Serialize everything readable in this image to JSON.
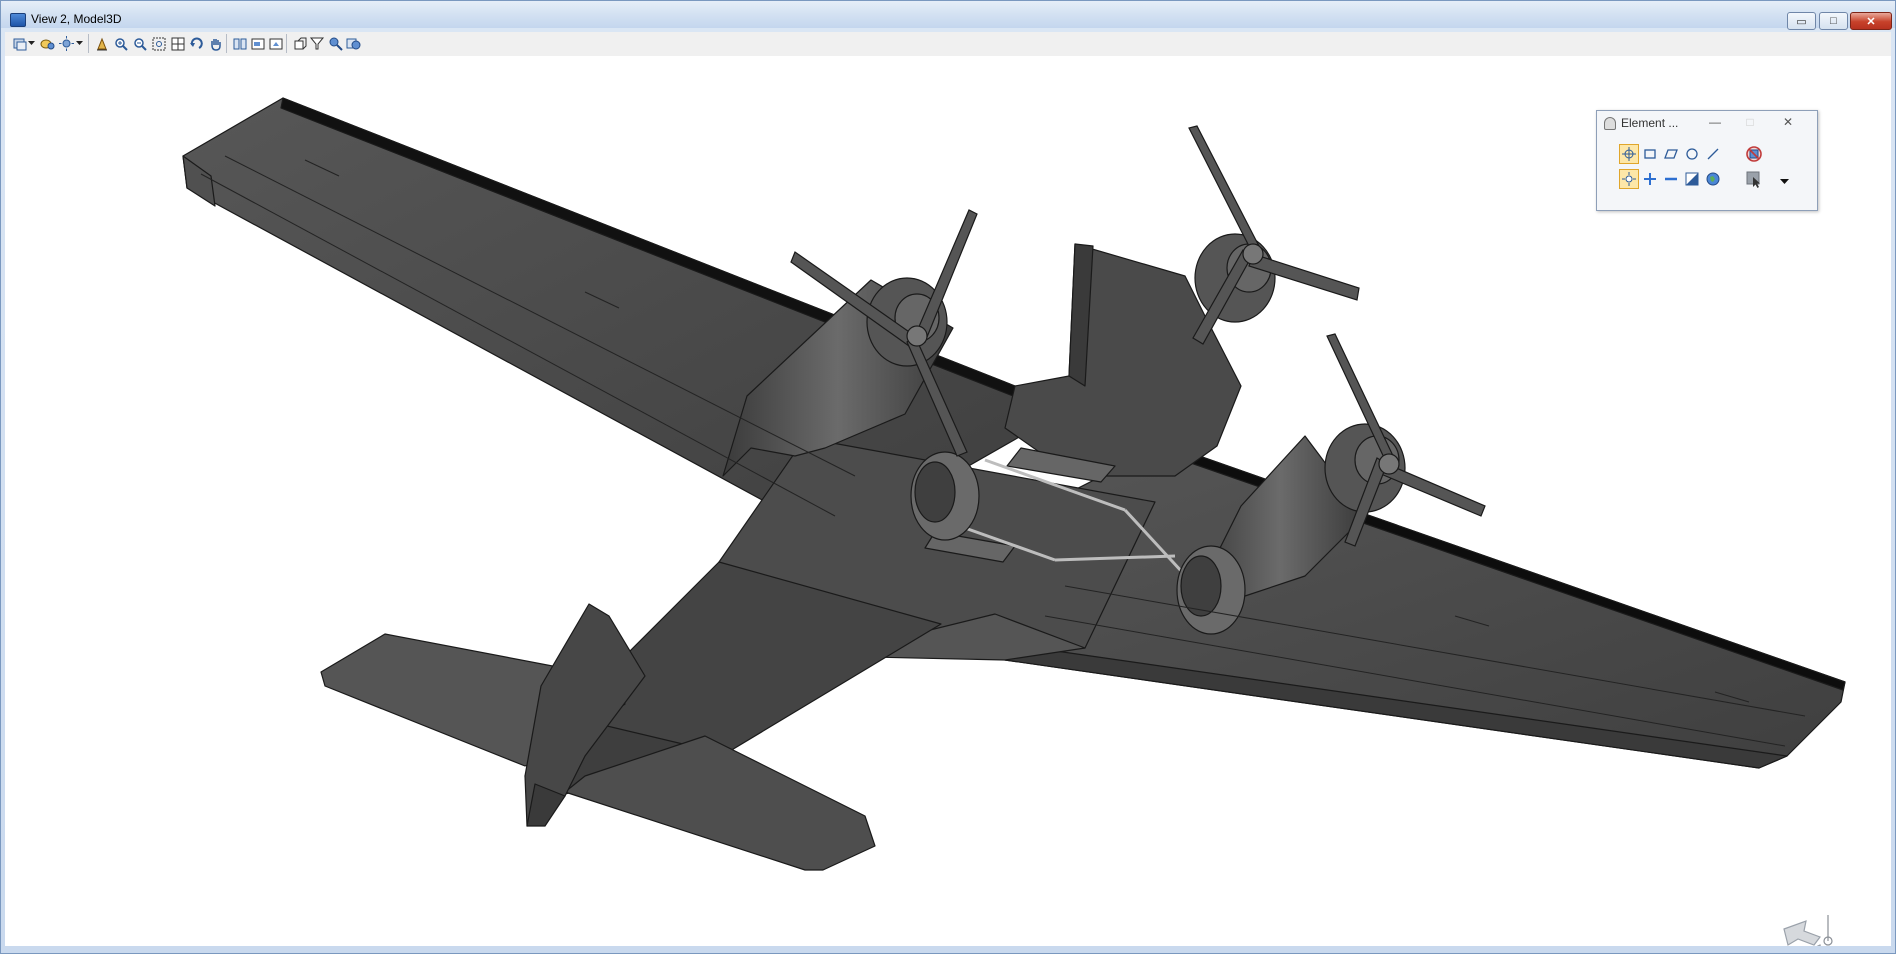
{
  "window": {
    "title": "View 2, Model3D",
    "controls": {
      "minimize": "▭",
      "maximize": "□",
      "close": "✕"
    }
  },
  "toolbar": {
    "buttons": [
      {
        "name": "view-display-mode",
        "icon": "display-mode-icon"
      },
      {
        "name": "view-display-dropdown",
        "icon": "chevron-down-icon"
      },
      {
        "name": "view-attributes",
        "icon": "view-attributes-icon"
      },
      {
        "name": "lighting",
        "icon": "sun-icon"
      },
      {
        "name": "lighting-dropdown",
        "icon": "chevron-down-icon"
      },
      {
        "name": "update-view",
        "icon": "pencil-icon"
      },
      {
        "name": "zoom-in",
        "icon": "zoom-in-icon"
      },
      {
        "name": "zoom-out",
        "icon": "zoom-out-icon"
      },
      {
        "name": "window-area",
        "icon": "window-area-icon"
      },
      {
        "name": "fit-view",
        "icon": "fit-view-icon"
      },
      {
        "name": "rotate-view",
        "icon": "rotate-view-icon"
      },
      {
        "name": "pan-view",
        "icon": "hand-icon"
      },
      {
        "name": "view-previous",
        "icon": "view-previous-icon"
      },
      {
        "name": "copy-view",
        "icon": "copy-view-icon"
      },
      {
        "name": "view-next",
        "icon": "view-next-icon"
      },
      {
        "name": "clip-volume",
        "icon": "clip-volume-icon"
      },
      {
        "name": "clip-mask",
        "icon": "funnel-icon"
      },
      {
        "name": "camera",
        "icon": "camera-icon"
      },
      {
        "name": "render",
        "icon": "render-icon"
      }
    ]
  },
  "palette": {
    "title": "Element ...",
    "controls": {
      "minimize": "—",
      "maximize": "□",
      "close": "✕"
    },
    "tools": [
      {
        "name": "element-selection",
        "icon": "crosshair-select-icon",
        "selected": true
      },
      {
        "name": "block-selection",
        "icon": "rectangle-icon"
      },
      {
        "name": "shape-selection",
        "icon": "parallelogram-icon"
      },
      {
        "name": "circle-selection",
        "icon": "circle-icon"
      },
      {
        "name": "line-selection",
        "icon": "line-icon"
      },
      {
        "name": "clear-selection",
        "icon": "no-select-icon"
      },
      {
        "name": "individual-mode",
        "icon": "sparkle-select-icon",
        "selected": true
      },
      {
        "name": "add-mode",
        "icon": "plus-icon"
      },
      {
        "name": "subtract-mode",
        "icon": "minus-icon"
      },
      {
        "name": "invert-mode",
        "icon": "invert-icon"
      },
      {
        "name": "select-all",
        "icon": "globe-icon"
      },
      {
        "name": "cursor-mode",
        "icon": "cursor-icon"
      },
      {
        "name": "more-options",
        "icon": "chevron-down-icon"
      }
    ]
  },
  "viewport": {
    "model": "aircraft-model",
    "background": "#ffffff",
    "model_color": "#4a4a4a"
  }
}
